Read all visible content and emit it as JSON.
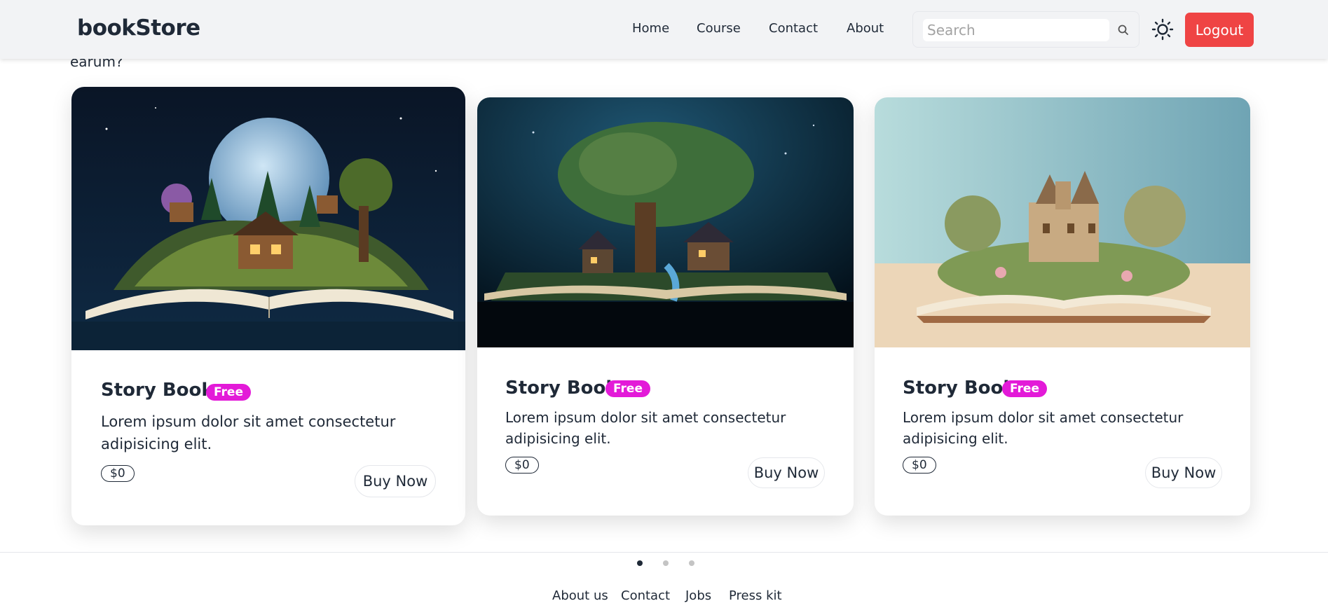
{
  "navbar": {
    "brand": "bookStore",
    "links": [
      "Home",
      "Course",
      "Contact",
      "About"
    ],
    "search_placeholder": "Search",
    "logout_label": "Logout"
  },
  "intro_text": "earum?",
  "cards": [
    {
      "title": "Story Book",
      "badge": "Free",
      "description": "Lorem ipsum dolor sit amet consectetur adipisicing elit.",
      "price": "$0",
      "button": "Buy Now"
    },
    {
      "title": "Story Book",
      "badge": "Free",
      "description": "Lorem ipsum dolor sit amet consectetur adipisicing elit.",
      "price": "$0",
      "button": "Buy Now"
    },
    {
      "title": "Story Book",
      "badge": "Free",
      "description": "Lorem ipsum dolor sit amet consectetur adipisicing elit.",
      "price": "$0",
      "button": "Buy Now"
    }
  ],
  "carousel": {
    "active_dot": 0,
    "dot_count": 3
  },
  "footer": {
    "links": [
      "About us",
      "Contact",
      "Jobs",
      "Press kit"
    ]
  },
  "colors": {
    "accent": "#ef4444",
    "badge": "#e31ad8",
    "text": "#1f2937",
    "navbar_bg": "#f2f3f5"
  }
}
